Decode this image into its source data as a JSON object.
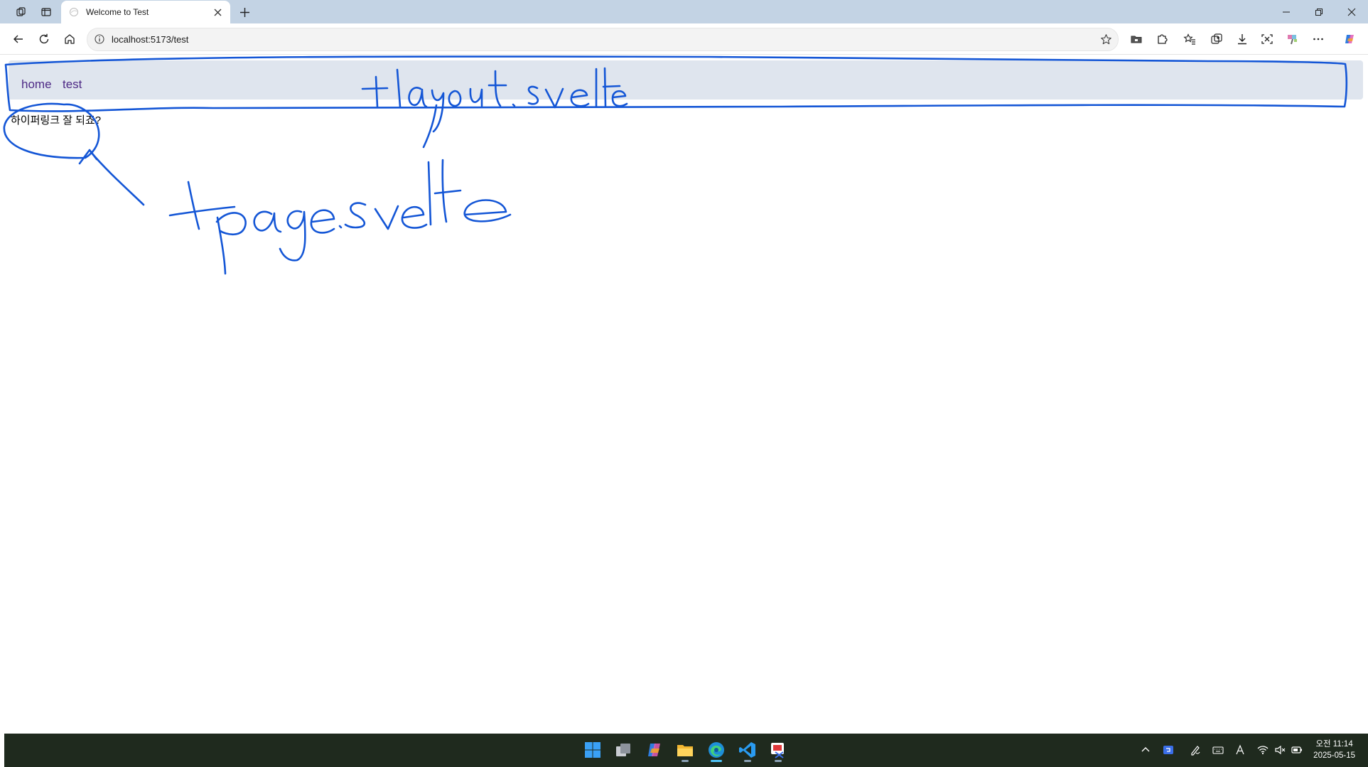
{
  "browser": {
    "tab": {
      "title": "Welcome to Test"
    },
    "address": {
      "url": "localhost:5173/test"
    }
  },
  "page": {
    "nav": [
      {
        "label": "home"
      },
      {
        "label": "test"
      }
    ],
    "text": "하이퍼링크 잘 되죠?"
  },
  "annotations": {
    "layout_label": "+layout.svelte",
    "page_label": "+page.svelte",
    "ink_color": "#1456d6"
  },
  "taskbar": {
    "apps": [
      {
        "name": "start",
        "icon": "windows-logo-icon"
      },
      {
        "name": "task-view",
        "icon": "task-view-icon"
      },
      {
        "name": "copilot",
        "icon": "copilot-icon"
      },
      {
        "name": "file-explorer",
        "icon": "folder-icon"
      },
      {
        "name": "edge",
        "icon": "edge-icon",
        "active": true
      },
      {
        "name": "vs-code",
        "icon": "vscode-icon"
      },
      {
        "name": "snipping-tool",
        "icon": "snipping-tool-icon"
      }
    ],
    "clock": {
      "time": "오전 11:14",
      "date": "2025-05-15"
    }
  }
}
